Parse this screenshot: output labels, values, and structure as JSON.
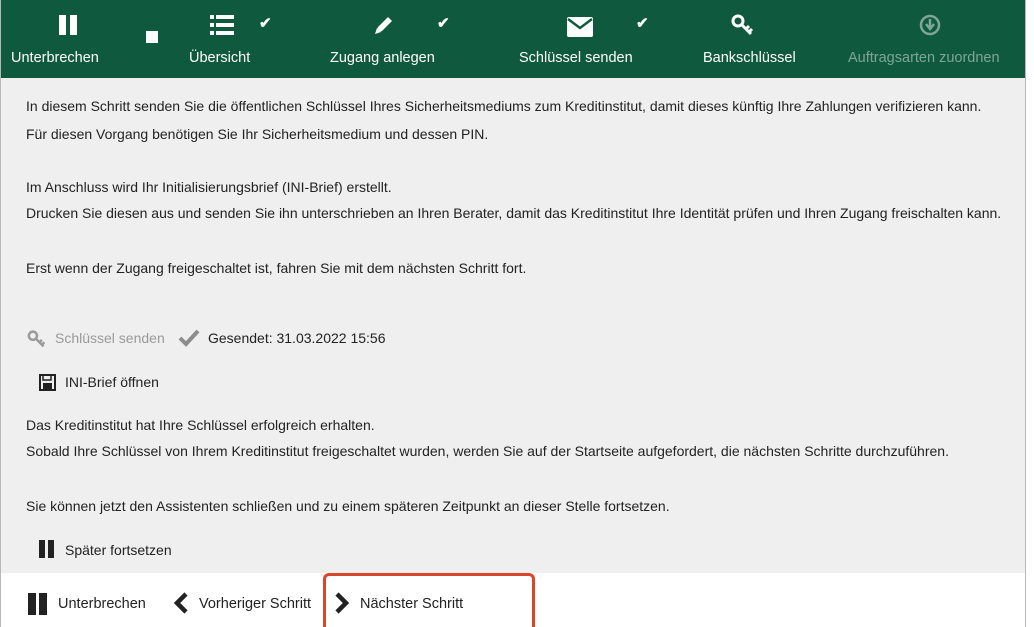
{
  "toolbar": {
    "items": [
      {
        "label": "Unterbrechen",
        "icon": "pause-icon",
        "checked": false,
        "enabled": true
      },
      {
        "label": "Übersicht",
        "icon": "list-icon",
        "checked": true,
        "enabled": true
      },
      {
        "label": "Zugang anlegen",
        "icon": "pencil-icon",
        "checked": true,
        "enabled": true
      },
      {
        "label": "Schlüssel senden",
        "icon": "envelope-icon",
        "checked": true,
        "enabled": true
      },
      {
        "label": "Bankschlüssel",
        "icon": "key-icon",
        "checked": false,
        "enabled": true
      },
      {
        "label": "Auftragsarten zuordnen",
        "icon": "download-circle-icon",
        "checked": false,
        "enabled": false
      }
    ],
    "check_glyph": "✔"
  },
  "content": {
    "p1_line1": "In diesem Schritt senden Sie die öffentlichen Schlüssel Ihres Sicherheitsmediums zum Kreditinstitut, damit dieses künftig Ihre Zahlungen verifizieren kann.",
    "p1_line2": "Für diesen Vorgang benötigen Sie Ihr Sicherheitsmedium und dessen PIN.",
    "p2_line1": "Im Anschluss wird Ihr Initialisierungsbrief (INI-Brief) erstellt.",
    "p2_line2": "Drucken Sie diesen aus und senden Sie ihn unterschrieben an Ihren Berater, damit das Kreditinstitut Ihre Identität prüfen und Ihren Zugang freischalten kann.",
    "p3": "Erst wenn der Zugang freigeschaltet ist, fahren Sie mit dem nächsten Schritt fort.",
    "send_keys_label": "Schlüssel senden",
    "sent_status": "Gesendet: 31.03.2022 15:56",
    "ini_letter_label": "INI-Brief öffnen",
    "p4_line1": "Das Kreditinstitut hat Ihre Schlüssel erfolgreich erhalten.",
    "p4_line2": "Sobald Ihre Schlüssel von Ihrem Kreditinstitut freigeschaltet wurden, werden Sie auf der Startseite aufgefordert, die nächsten Schritte durchzuführen.",
    "p5": "Sie können jetzt den Assistenten schließen und zu einem späteren Zeitpunkt an dieser Stelle fortsetzen.",
    "continue_later_label": "Später fortsetzen"
  },
  "footer": {
    "pause_label": "Unterbrechen",
    "prev_label": "Vorheriger Schritt",
    "next_label": "Nächster Schritt"
  },
  "colors": {
    "toolbar_bg": "#0f5a3e",
    "content_bg": "#efefef",
    "highlight": "#d9472b",
    "disabled": "#7fa595"
  }
}
